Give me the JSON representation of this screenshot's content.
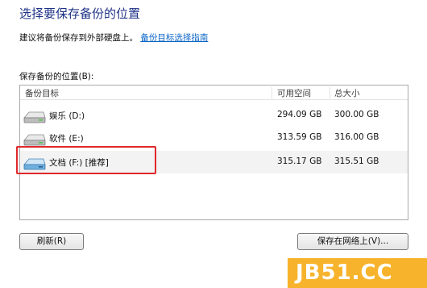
{
  "dialog": {
    "title": "选择要保存备份的位置",
    "advice_text": "建议将备份保存到外部硬盘上。",
    "advice_link": "备份目标选择指南",
    "location_label": "保存备份的位置(B):"
  },
  "list": {
    "columns": [
      "备份目标",
      "可用空间",
      "总大小"
    ],
    "rows": [
      {
        "name": "娱乐 (D:)",
        "free": "294.09 GB",
        "total": "300.00 GB",
        "selected": false,
        "icon": "hard-drive-icon"
      },
      {
        "name": "软件 (E:)",
        "free": "313.59 GB",
        "total": "316.00 GB",
        "selected": false,
        "icon": "hard-drive-icon"
      },
      {
        "name": "文档 (F:) [推荐]",
        "free": "315.17 GB",
        "total": "315.51 GB",
        "selected": true,
        "icon": "hard-drive-icon"
      }
    ]
  },
  "buttons": {
    "refresh": "刷新(R)",
    "save_network": "保存在网络上(V)..."
  },
  "colors": {
    "title": "#1e3287",
    "link": "#0b66c8",
    "highlight_box": "#e0282b",
    "watermark_bg": "#f7b32b"
  },
  "watermark": "JB51.CC"
}
